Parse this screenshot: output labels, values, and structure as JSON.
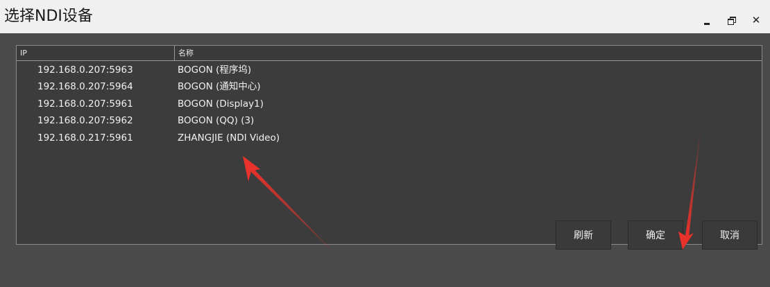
{
  "window": {
    "title": "选择NDI设备",
    "controls": {
      "minimize_icon": "minimize-icon",
      "restore_icon": "restore-icon",
      "close_label": "✕"
    }
  },
  "table": {
    "columns": {
      "ip": "IP",
      "name": "名称"
    },
    "rows": [
      {
        "ip": "192.168.0.207:5963",
        "name": "BOGON (程序坞)"
      },
      {
        "ip": "192.168.0.207:5964",
        "name": "BOGON (通知中心)"
      },
      {
        "ip": "192.168.0.207:5961",
        "name": "BOGON (Display1)"
      },
      {
        "ip": "192.168.0.207:5962",
        "name": "BOGON (QQ) (3)"
      },
      {
        "ip": "192.168.0.217:5961",
        "name": "ZHANGJIE (NDI Video)"
      }
    ]
  },
  "buttons": {
    "refresh": "刷新",
    "ok": "确定",
    "cancel": "取消"
  },
  "colors": {
    "title_bar": "#f0f0f0",
    "client_bg": "#4a4a4a",
    "table_bg": "#3c3c3c",
    "annotation_arrow": "#e8322b"
  }
}
